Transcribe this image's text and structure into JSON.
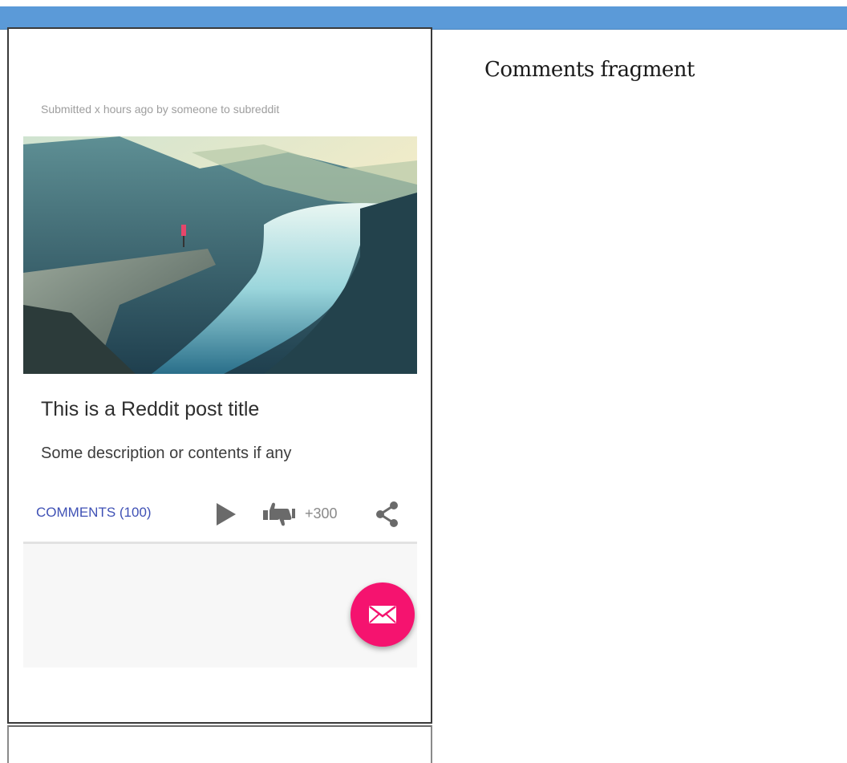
{
  "post": {
    "submitted_text": "Submitted x hours ago by someone to subreddit",
    "title": "This is a Reddit post title",
    "description": "Some description or contents if any",
    "comments_label": "COMMENTS (100)",
    "score": "+300"
  },
  "fragment_label": "Comments fragment",
  "icons": {
    "play": "play-icon",
    "vote": "thumbs-up-down-icon",
    "share": "share-icon",
    "fab": "mail-icon"
  },
  "colors": {
    "top_bar": "#5b9ad8",
    "comments_link": "#3f51b5",
    "fab": "#f5136f"
  }
}
